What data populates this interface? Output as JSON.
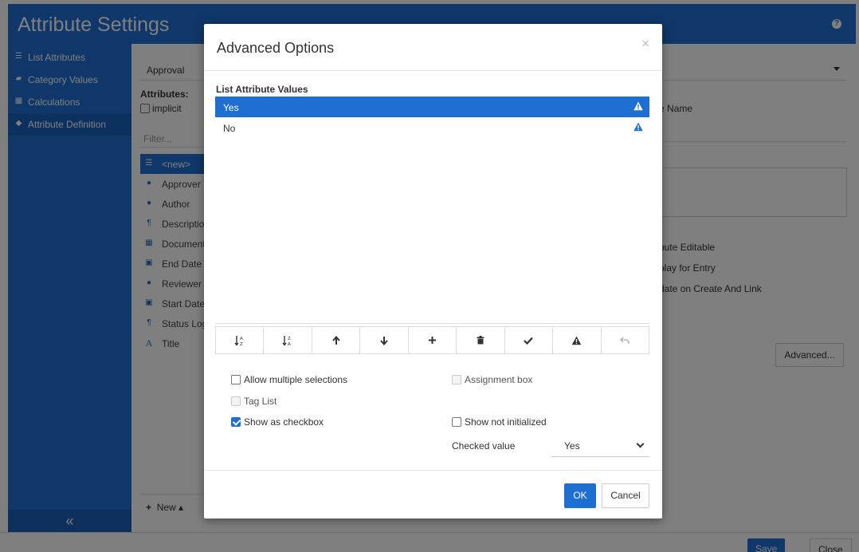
{
  "app": {
    "title": "Attribute Settings",
    "help_icon": "question-circle-icon"
  },
  "sidebar": {
    "items": [
      {
        "label": "List Attributes",
        "icon": "list-icon"
      },
      {
        "label": "Category Values",
        "icon": "folder-icon"
      },
      {
        "label": "Calculations",
        "icon": "calculator-icon"
      },
      {
        "label": "Attribute Definition",
        "icon": "tag-icon",
        "active": true
      }
    ],
    "collapse_icon": "double-chevron-left-icon"
  },
  "main": {
    "category_select": "Approval",
    "attributes_label": "Attributes:",
    "implicit_label": "implicit",
    "filter_placeholder": "Filter...",
    "attributes": [
      {
        "label": "<new>",
        "icon": "list-icon",
        "selected": true
      },
      {
        "label": "Approver",
        "icon": "user-icon"
      },
      {
        "label": "Author",
        "icon": "user-icon"
      },
      {
        "label": "Descriptio",
        "icon": "paragraph-icon"
      },
      {
        "label": "Document",
        "icon": "table-icon"
      },
      {
        "label": "End Date",
        "icon": "calendar-icon"
      },
      {
        "label": "Reviewer",
        "icon": "user-icon"
      },
      {
        "label": "Start Date",
        "icon": "calendar-icon"
      },
      {
        "label": "Status Log",
        "icon": "paragraph-icon"
      },
      {
        "label": "Title",
        "icon": "text-icon"
      }
    ],
    "name_label": "e Name",
    "editable_label": "bute Editable",
    "display_label": "olay for Entry",
    "create_link_label": "date on Create And Link",
    "advanced_button": "Advanced...",
    "new_button": "New"
  },
  "footer": {
    "save_button": "Save",
    "close_button": "Close"
  },
  "modal": {
    "title": "Advanced Options",
    "close_glyph": "×",
    "section_label": "List Attribute Values",
    "values": [
      {
        "label": "Yes",
        "selected": true,
        "icon": "warning-icon"
      },
      {
        "label": "No",
        "selected": false,
        "icon": "warning-icon"
      }
    ],
    "toolbar": [
      {
        "name": "sort-ascending-button",
        "icon": "sort-alpha-asc-icon"
      },
      {
        "name": "sort-descending-button",
        "icon": "sort-alpha-desc-icon"
      },
      {
        "name": "move-up-button",
        "icon": "arrow-up-icon"
      },
      {
        "name": "move-down-button",
        "icon": "arrow-down-icon"
      },
      {
        "name": "add-value-button",
        "icon": "plus-icon"
      },
      {
        "name": "delete-value-button",
        "icon": "trash-icon"
      },
      {
        "name": "set-default-button",
        "icon": "check-icon"
      },
      {
        "name": "mark-warning-button",
        "icon": "warning-icon"
      },
      {
        "name": "undo-button",
        "icon": "undo-icon",
        "disabled": true
      }
    ],
    "options": {
      "allow_multiple": {
        "label": "Allow multiple selections",
        "checked": false
      },
      "tag_list": {
        "label": "Tag List",
        "checked": false,
        "disabled": true
      },
      "show_as_checkbox": {
        "label": "Show as checkbox",
        "checked": true
      },
      "assignment_box": {
        "label": "Assignment box",
        "checked": false,
        "disabled": true
      },
      "show_not_initialized": {
        "label": "Show not initialized",
        "checked": false
      }
    },
    "checked_value_label": "Checked value",
    "checked_value": "Yes",
    "ok_button": "OK",
    "cancel_button": "Cancel"
  },
  "colors": {
    "accent": "#1e6fd2",
    "overlay": "rgba(0,0,0,0.5)"
  }
}
